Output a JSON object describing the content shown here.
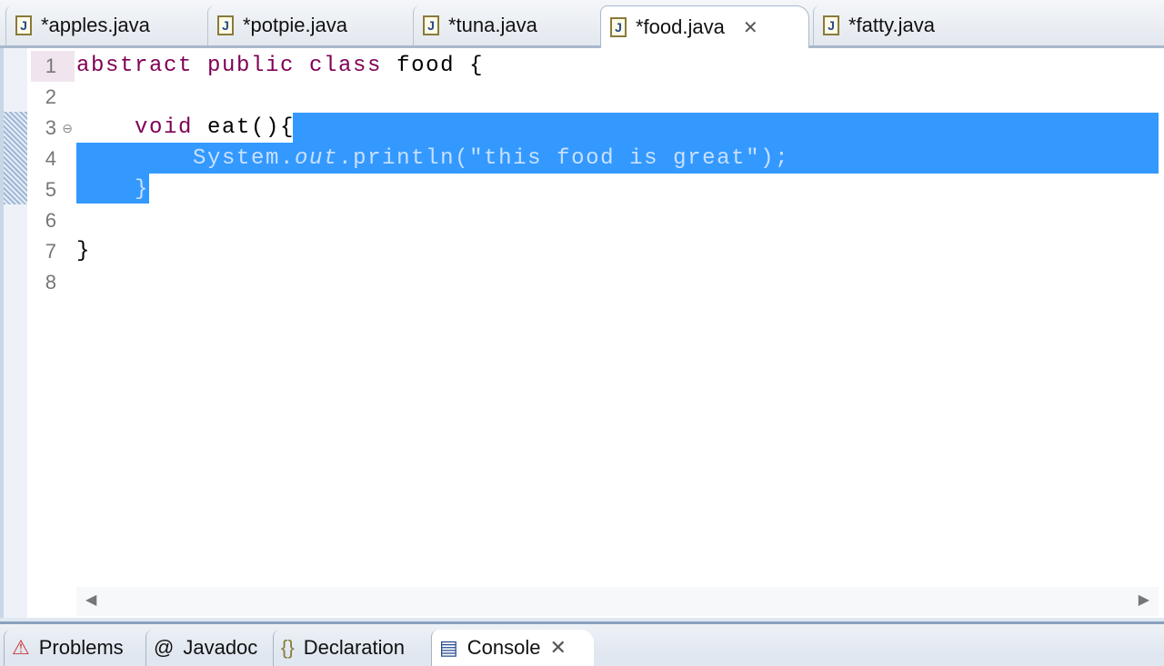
{
  "tabs": [
    {
      "label": "*apples.java",
      "icon": "java-file-icon"
    },
    {
      "label": "*potpie.java",
      "icon": "java-file-icon"
    },
    {
      "label": "*tuna.java",
      "icon": "java-file-icon"
    },
    {
      "label": "*food.java",
      "icon": "java-file-icon",
      "active": true,
      "close": "✕"
    },
    {
      "label": "*fatty.java",
      "icon": "java-file-icon"
    }
  ],
  "java_icon_letter": "J",
  "line_numbers": [
    "1",
    "2",
    "3",
    "4",
    "5",
    "6",
    "7",
    "8"
  ],
  "code": {
    "l1_kw": "abstract public class",
    "l1_rest": " food {",
    "l3_kw": "    void",
    "l3_rest": " eat(){",
    "l4": "        System.",
    "l4_italic": "out",
    "l4_rest": ".println(\"this food is great\");",
    "l5": "    }",
    "l7": "}"
  },
  "selection_color": "#3399ff",
  "keyword_color": "#7f0055",
  "scroll": {
    "left": "◀",
    "right": "▶"
  },
  "bottom_tabs": [
    {
      "label": "Problems",
      "icon": "⚠"
    },
    {
      "label": "Javadoc",
      "icon": "@"
    },
    {
      "label": "Declaration",
      "icon": "{}"
    },
    {
      "label": "Console",
      "icon": "▤",
      "close": "✕"
    }
  ]
}
